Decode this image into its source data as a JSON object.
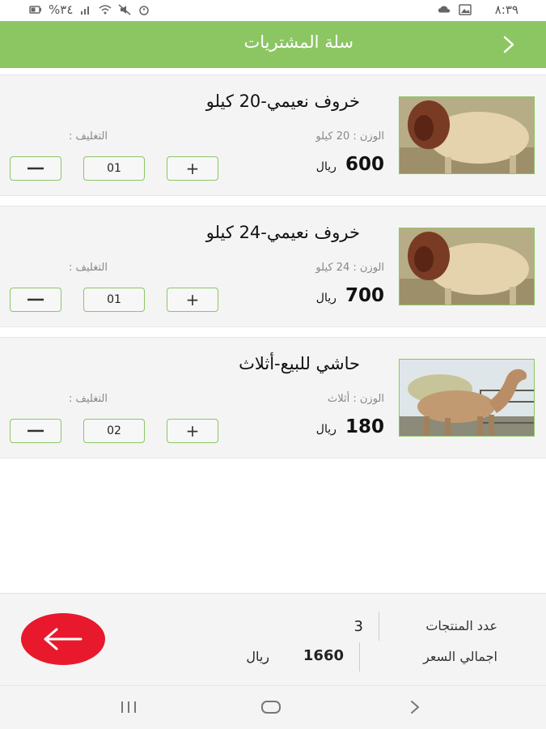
{
  "status_bar": {
    "time": "٨:٣٩",
    "battery": "%٣٤"
  },
  "header": {
    "title": "سلة المشتريات",
    "back_icon": "chevron-right-icon"
  },
  "cart_items": [
    {
      "title": "خروف نعيمي-20 كيلو",
      "weight": "الوزن : 20 كيلو",
      "packing": "التغليف :",
      "price": "600",
      "currency": "ريال",
      "quantity": "01",
      "plus": "+",
      "image": "sheep-photo"
    },
    {
      "title": "خروف نعيمي-24 كيلو",
      "weight": "الوزن : 24 كيلو",
      "packing": "التغليف :",
      "price": "700",
      "currency": "ريال",
      "quantity": "01",
      "plus": "+",
      "image": "sheep-photo"
    },
    {
      "title": "حاشي للبيع-أثلاث",
      "weight": "الوزن : أثلاث",
      "packing": "التغليف :",
      "price": "180",
      "currency": "ريال",
      "quantity": "02",
      "plus": "+",
      "image": "camel-photo"
    }
  ],
  "summary": {
    "count_label": "عدد المنتجات",
    "count_value": "3",
    "total_label": "اجمالي السعر",
    "total_value": "1660",
    "total_currency": "ريال"
  },
  "colors": {
    "header": "#8cc663",
    "accent_button": "#e8192c"
  }
}
